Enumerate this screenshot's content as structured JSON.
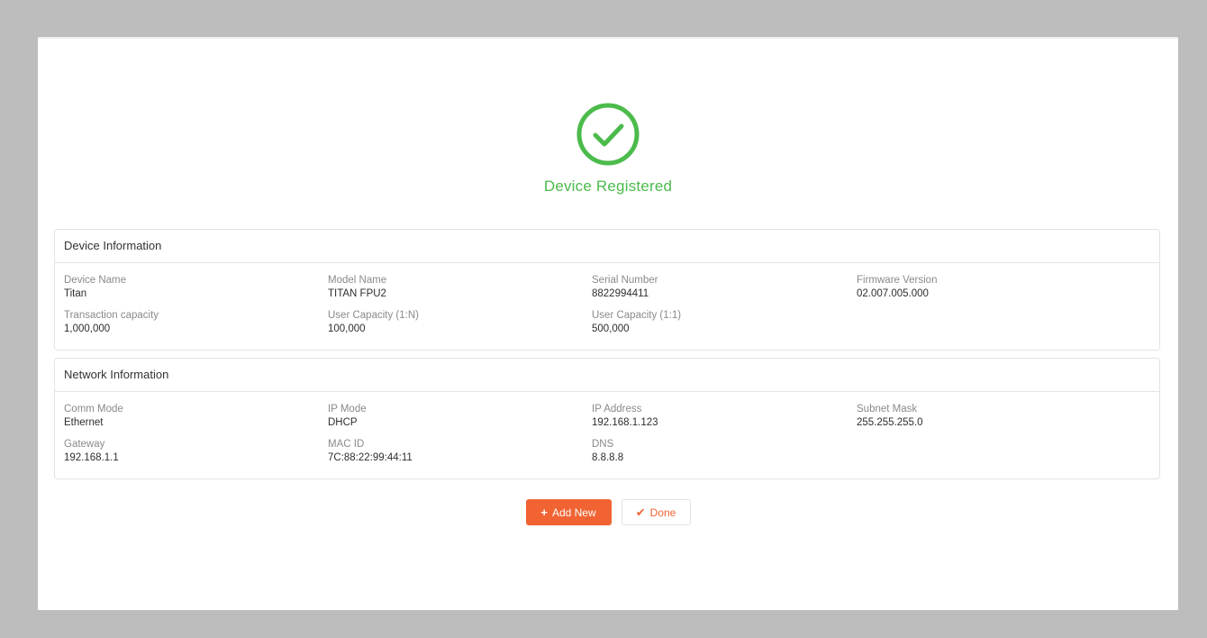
{
  "status": {
    "title": "Device Registered",
    "icon": "check-circle-icon",
    "color": "#4cbb4c"
  },
  "device_info": {
    "title": "Device Information",
    "fields": [
      {
        "label": "Device Name",
        "value": "Titan"
      },
      {
        "label": "Model Name",
        "value": "TITAN FPU2"
      },
      {
        "label": "Serial Number",
        "value": "8822994411"
      },
      {
        "label": "Firmware Version",
        "value": "02.007.005.000"
      },
      {
        "label": "Transaction capacity",
        "value": "1,000,000"
      },
      {
        "label": "User Capacity (1:N)",
        "value": "100,000"
      },
      {
        "label": "User Capacity (1:1)",
        "value": "500,000"
      }
    ]
  },
  "network_info": {
    "title": "Network Information",
    "fields": [
      {
        "label": "Comm Mode",
        "value": "Ethernet"
      },
      {
        "label": "IP Mode",
        "value": "DHCP"
      },
      {
        "label": "IP Address",
        "value": "192.168.1.123"
      },
      {
        "label": "Subnet Mask",
        "value": "255.255.255.0"
      },
      {
        "label": "Gateway",
        "value": "192.168.1.1"
      },
      {
        "label": "MAC ID",
        "value": "7C:88:22:99:44:11"
      },
      {
        "label": "DNS",
        "value": "8.8.8.8"
      }
    ]
  },
  "actions": {
    "add_new_label": "Add New",
    "add_new_icon": "plus-icon",
    "done_label": "Done",
    "done_icon": "check-icon",
    "accent_color": "#f16332"
  }
}
